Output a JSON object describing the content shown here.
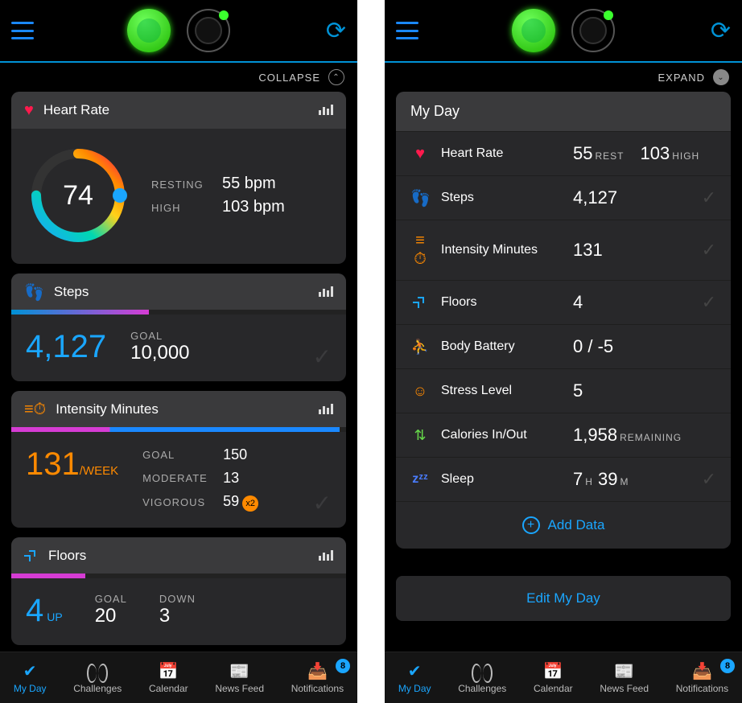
{
  "left": {
    "collapse_label": "COLLAPSE",
    "hr": {
      "title": "Heart Rate",
      "current": "74",
      "resting_lbl": "RESTING",
      "resting_val": "55 bpm",
      "high_lbl": "HIGH",
      "high_val": "103 bpm"
    },
    "steps": {
      "title": "Steps",
      "value": "4,127",
      "goal_lbl": "GOAL",
      "goal_val": "10,000",
      "progress_pct": 41
    },
    "intensity": {
      "title": "Intensity Minutes",
      "value": "131",
      "unit": "/WEEK",
      "goal_lbl": "GOAL",
      "goal_val": "150",
      "mod_lbl": "MODERATE",
      "mod_val": "13",
      "vig_lbl": "VIGOROUS",
      "vig_val": "59",
      "x2": "x2",
      "progress_pct": 98
    },
    "floors": {
      "title": "Floors",
      "value": "4",
      "unit": "UP",
      "goal_lbl": "GOAL",
      "goal_val": "20",
      "down_lbl": "DOWN",
      "down_val": "3",
      "progress_pct": 22
    }
  },
  "right": {
    "expand_label": "EXPAND",
    "header": "My Day",
    "rows": {
      "hr": {
        "label": "Heart Rate",
        "v1": "55",
        "s1": "REST",
        "v2": "103",
        "s2": "HIGH"
      },
      "steps": {
        "label": "Steps",
        "value": "4,127"
      },
      "intensity": {
        "label": "Intensity Minutes",
        "value": "131"
      },
      "floors": {
        "label": "Floors",
        "value": "4"
      },
      "body": {
        "label": "Body Battery",
        "value": "0 / -5"
      },
      "stress": {
        "label": "Stress Level",
        "value": "5"
      },
      "cal": {
        "label": "Calories In/Out",
        "value": "1,958",
        "sub": "REMAINING"
      },
      "sleep": {
        "label": "Sleep",
        "h": "7",
        "hl": "H",
        "m": "39",
        "ml": "M"
      }
    },
    "add_data": "Add Data",
    "edit": "Edit My Day"
  },
  "nav": {
    "myday": "My Day",
    "challenges": "Challenges",
    "calendar": "Calendar",
    "newsfeed": "News Feed",
    "notifications": "Notifications",
    "badge": "8"
  }
}
